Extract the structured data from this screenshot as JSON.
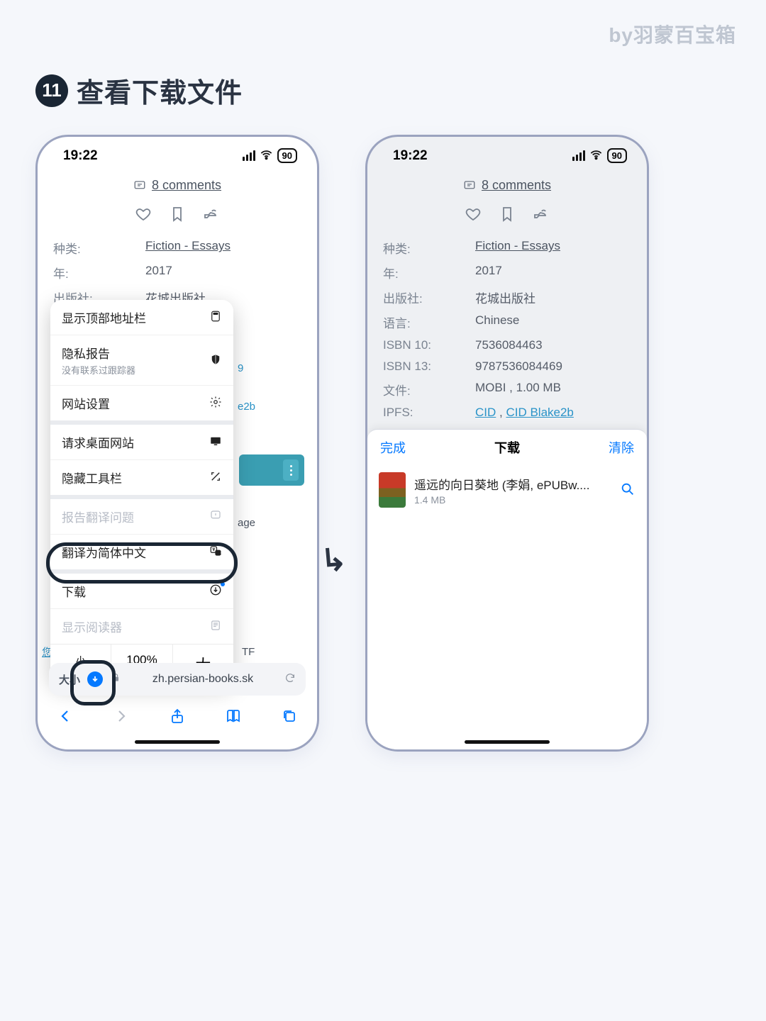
{
  "watermark": "by羽蒙百宝箱",
  "step": {
    "num": "11",
    "title": "查看下载文件"
  },
  "status": {
    "time": "19:22",
    "battery": "90"
  },
  "comments_link": "8 comments",
  "meta": {
    "kind_k": "种类:",
    "kind_v": "Fiction - Essays",
    "year_k": "年:",
    "year_v": "2017",
    "pub_k": "出版社:",
    "pub_v": "花城出版社",
    "lang_k": "语言:",
    "lang_v": "Chinese",
    "isbn10_k": "ISBN 10:",
    "isbn10_v": "7536084463",
    "isbn13_k": "ISBN 13:",
    "isbn13_v": "9787536084469",
    "file_k": "文件:",
    "file_v": "MOBI , 1.00 MB",
    "ipfs_k": "IPFS:",
    "ipfs_cid": "CID",
    "ipfs_sep": " , ",
    "ipfs_blake": "CID Blake2b"
  },
  "popup": {
    "show_addr": "显示顶部地址栏",
    "privacy": "隐私报告",
    "privacy_sub": "没有联系过跟踪器",
    "site_settings": "网站设置",
    "desktop": "请求桌面网站",
    "hide_toolbar": "隐藏工具栏",
    "report_trans": "报告翻译问题",
    "translate": "翻译为简体中文",
    "downloads": "下载",
    "reader": "显示阅读器",
    "zoom_small": "小",
    "zoom_pct": "100%",
    "zoom_big": "大"
  },
  "peek": {
    "isbn13_tail": "9",
    "ipfs_tail": "e2b",
    "age_tail": "age",
    "tf_tail": "TF",
    "you": "您"
  },
  "addr": {
    "aa": "大小",
    "url": "zh.persian-books.sk"
  },
  "sheet": {
    "done": "完成",
    "title": "下载",
    "clear": "清除",
    "file_name": "遥远的向日葵地 (李娟, ePUBw....",
    "file_size": "1.4 MB"
  }
}
